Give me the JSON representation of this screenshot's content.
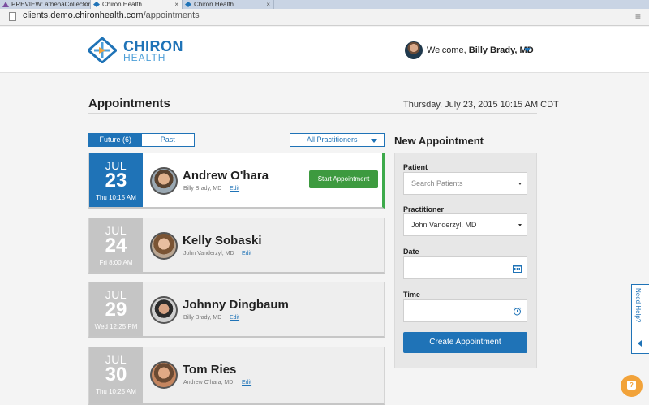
{
  "browser": {
    "tabs": [
      {
        "label": "PREVIEW: athenaCollector"
      },
      {
        "label": "Chiron Health"
      },
      {
        "label": "Chiron Health"
      }
    ],
    "url_host": "clients.demo.chironhealth.com",
    "url_path": "/appointments"
  },
  "header": {
    "logo_primary": "CHIRON",
    "logo_secondary": "HEALTH",
    "welcome_prefix": "Welcome,",
    "user_name": "Billy Brady, MD"
  },
  "page": {
    "title": "Appointments",
    "datetime": "Thursday, July 23, 2015 10:15 AM CDT"
  },
  "toggle": {
    "future_label": "Future (6)",
    "past_label": "Past"
  },
  "filter": {
    "label": "All Practitioners"
  },
  "appointments": [
    {
      "month": "JUL",
      "day": "23",
      "time": "Thu 10:15 AM",
      "patient": "Andrew O'hara",
      "practitioner": "Billy Brady, MD",
      "edit": "Edit",
      "action": "Start Appointment"
    },
    {
      "month": "JUL",
      "day": "24",
      "time": "Fri 8:00 AM",
      "patient": "Kelly Sobaski",
      "practitioner": "John Vanderzyl, MD",
      "edit": "Edit"
    },
    {
      "month": "JUL",
      "day": "29",
      "time": "Wed 12:25 PM",
      "patient": "Johnny Dingbaum",
      "practitioner": "Billy Brady, MD",
      "edit": "Edit"
    },
    {
      "month": "JUL",
      "day": "30",
      "time": "Thu 10:25 AM",
      "patient": "Tom Ries",
      "practitioner": "Andrew O'hara, MD",
      "edit": "Edit"
    }
  ],
  "new_appointment": {
    "title": "New Appointment",
    "patient_label": "Patient",
    "patient_placeholder": "Search Patients",
    "practitioner_label": "Practitioner",
    "practitioner_value": "John Vanderzyl, MD",
    "date_label": "Date",
    "time_label": "Time",
    "submit_label": "Create Appointment"
  },
  "help": {
    "label": "Need Help?"
  },
  "colors": {
    "brand_blue": "#1f73b7",
    "success_green": "#3d9a3f",
    "chat_orange": "#f2a33a"
  }
}
